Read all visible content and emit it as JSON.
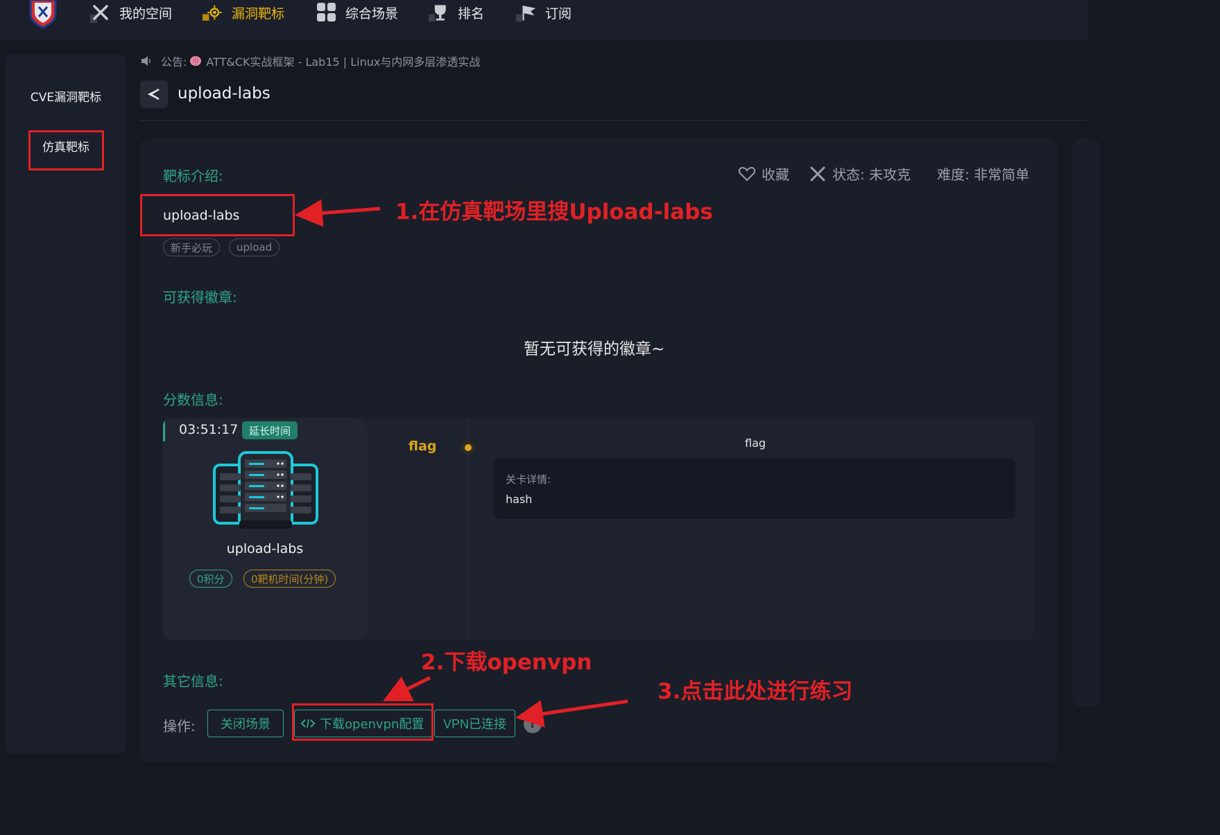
{
  "nav": {
    "items": [
      {
        "label": "我的空间",
        "icon": "crossed-swords-icon"
      },
      {
        "label": "漏洞靶标",
        "icon": "target-sun-icon",
        "active": true
      },
      {
        "label": "综合场景",
        "icon": "grid-icon"
      },
      {
        "label": "排名",
        "icon": "trophy-icon"
      },
      {
        "label": "订阅",
        "icon": "flag-icon"
      }
    ],
    "active_color": "#e9b30d"
  },
  "sidebar": {
    "items": [
      {
        "label": "CVE漏洞靶标"
      },
      {
        "label": "仿真靶标",
        "highlighted": true
      }
    ]
  },
  "notice": {
    "prefix": "公告:",
    "text": "ATT&CK实战框架 - Lab15 | Linux与内网多层渗透实战"
  },
  "page": {
    "title": "upload-labs"
  },
  "intro": {
    "section_title": "靶标介绍:",
    "favorite_label": "收藏",
    "status_label": "状态: 未攻克",
    "difficulty_label": "难度: 非常简单",
    "name": "upload-labs",
    "tags": [
      "新手必玩",
      "upload"
    ]
  },
  "badges": {
    "section_title": "可获得徽章:",
    "empty_text": "暂无可获得的徽章~"
  },
  "score": {
    "section_title": "分数信息:",
    "timer": "03:51:17",
    "extend_label": "延长时间",
    "machine_name": "upload-labs",
    "points_pill": "0积分",
    "time_pill": "0靶机时间(分钟)",
    "flag_label": "flag",
    "flag_head": "flag",
    "detail_label": "关卡详情:",
    "detail_value": "hash"
  },
  "other": {
    "section_title": "其它信息:",
    "ops_label": "操作:",
    "close_button": "关闭场景",
    "download_button": "下载openvpn配置",
    "vpn_button": "VPN已连接",
    "help": "?"
  },
  "annotations": {
    "step1": "1.在仿真靶场里搜Upload-labs",
    "step2": "2.下载openvpn",
    "step3": "3.点击此处进行练习",
    "color": "#e12125"
  },
  "colors": {
    "accent_green": "#2fa58c",
    "gold": "#d9a51c",
    "background": "#141821",
    "card": "#1a1e29"
  }
}
